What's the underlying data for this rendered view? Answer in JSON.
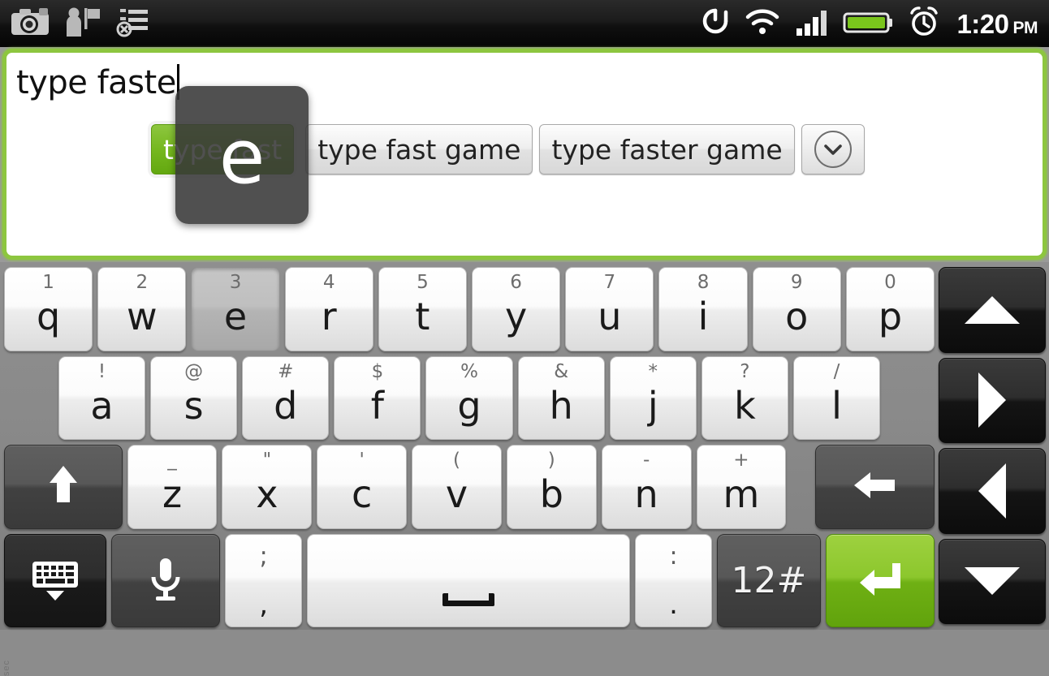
{
  "statusbar": {
    "icons_left": [
      "camera-icon",
      "person-flag-icon",
      "checklist-icon"
    ],
    "icons_right": [
      "sync-icon",
      "wifi-icon",
      "signal-icon",
      "battery-icon",
      "alarm-icon"
    ],
    "time": "1:20",
    "ampm": "PM",
    "battery_color": "#7ac51c",
    "text_color": "#ffffff"
  },
  "textfield": {
    "value": "type faste",
    "focus_border_color": "#8dc63f",
    "background": "#ffffff"
  },
  "keypopup": {
    "letter": "e"
  },
  "suggestions": {
    "items": [
      {
        "label": "type fast",
        "active": true
      },
      {
        "label": "type fast game",
        "active": false
      },
      {
        "label": "type faster game",
        "active": false
      }
    ],
    "more_icon": "chevron-down-icon",
    "active_color": "#76b81f"
  },
  "keyboard": {
    "side_mark": "sec",
    "row1": [
      {
        "main": "q",
        "sub": "1",
        "pressed": false
      },
      {
        "main": "w",
        "sub": "2",
        "pressed": false
      },
      {
        "main": "e",
        "sub": "3",
        "pressed": true
      },
      {
        "main": "r",
        "sub": "4",
        "pressed": false
      },
      {
        "main": "t",
        "sub": "5",
        "pressed": false
      },
      {
        "main": "y",
        "sub": "6",
        "pressed": false
      },
      {
        "main": "u",
        "sub": "7",
        "pressed": false
      },
      {
        "main": "i",
        "sub": "8",
        "pressed": false
      },
      {
        "main": "o",
        "sub": "9",
        "pressed": false
      },
      {
        "main": "p",
        "sub": "0",
        "pressed": false
      }
    ],
    "row2": [
      {
        "main": "a",
        "sub": "!"
      },
      {
        "main": "s",
        "sub": "@"
      },
      {
        "main": "d",
        "sub": "#"
      },
      {
        "main": "f",
        "sub": "$"
      },
      {
        "main": "g",
        "sub": "%"
      },
      {
        "main": "h",
        "sub": "&"
      },
      {
        "main": "j",
        "sub": "*"
      },
      {
        "main": "k",
        "sub": "?"
      },
      {
        "main": "l",
        "sub": "/"
      }
    ],
    "row3": {
      "shift_icon": "shift-arrow-up-icon",
      "letters": [
        {
          "main": "z",
          "sub": "_"
        },
        {
          "main": "x",
          "sub": "\""
        },
        {
          "main": "c",
          "sub": "'"
        },
        {
          "main": "v",
          "sub": "("
        },
        {
          "main": "b",
          "sub": ")"
        },
        {
          "main": "n",
          "sub": "-"
        },
        {
          "main": "m",
          "sub": "+"
        }
      ],
      "backspace_icon": "backspace-arrow-left-icon"
    },
    "row4": {
      "hide_keyboard_icon": "hide-keyboard-icon",
      "mic_icon": "microphone-icon",
      "semicolon_key": {
        "top": ";",
        "bottom": ","
      },
      "space_icon": "space-bar-icon",
      "colon_key": {
        "top": ":",
        "bottom": "."
      },
      "symbols_label": "12#",
      "enter_icon": "enter-return-icon",
      "enter_color": "#76b81f"
    },
    "arrows": [
      {
        "icon": "arrow-up-icon",
        "dir": "up"
      },
      {
        "icon": "arrow-right-icon",
        "dir": "right"
      },
      {
        "icon": "arrow-left-icon",
        "dir": "left"
      },
      {
        "icon": "arrow-down-icon",
        "dir": "down"
      }
    ]
  }
}
